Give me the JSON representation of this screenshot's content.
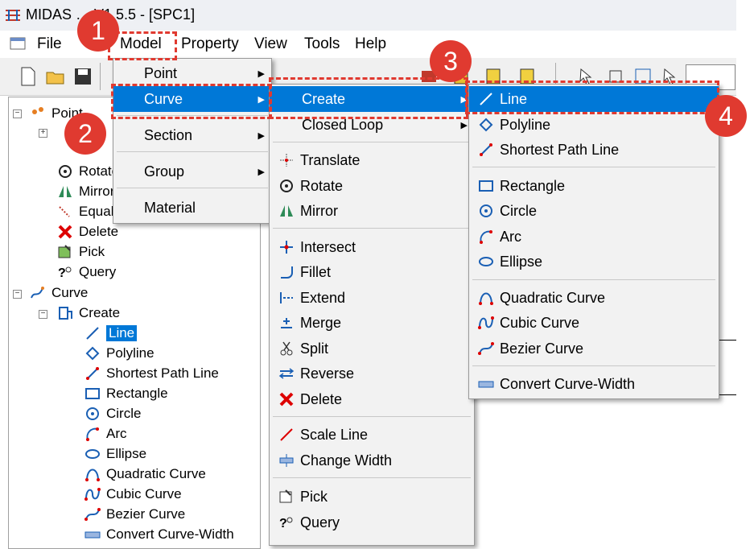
{
  "app": {
    "title": "MIDAS … V1.5.5 - [SPC1]"
  },
  "menubar": {
    "file": "File",
    "model": "Model",
    "property": "Property",
    "view": "View",
    "tools": "Tools",
    "help": "Help"
  },
  "model_menu": {
    "items": [
      "Point",
      "Curve",
      "Section",
      "Group",
      "Material"
    ]
  },
  "curve_menu": {
    "items": [
      "Create",
      "Closed Loop",
      "Translate",
      "Rotate",
      "Mirror",
      "Intersect",
      "Fillet",
      "Extend",
      "Merge",
      "Split",
      "Reverse",
      "Delete",
      "Scale Line",
      "Change Width",
      "Pick",
      "Query"
    ]
  },
  "create_menu": {
    "items": [
      "Line",
      "Polyline",
      "Shortest Path Line",
      "Rectangle",
      "Circle",
      "Arc",
      "Ellipse",
      "Quadratic Curve",
      "Cubic Curve",
      "Bezier Curve",
      "Convert Curve-Width"
    ]
  },
  "tree": {
    "items": [
      "Point",
      "Rotate",
      "Mirror",
      "Equal",
      "Delete",
      "Pick",
      "Query",
      "Curve",
      "Create",
      "Line",
      "Polyline",
      "Shortest Path Line",
      "Rectangle",
      "Circle",
      "Arc",
      "Ellipse",
      "Quadratic Curve",
      "Cubic Curve",
      "Bezier Curve",
      "Convert Curve-Width"
    ]
  },
  "badges": [
    "1",
    "2",
    "3",
    "4"
  ],
  "colors": {
    "highlight": "#0078d7",
    "annotation": "#e03a30"
  }
}
